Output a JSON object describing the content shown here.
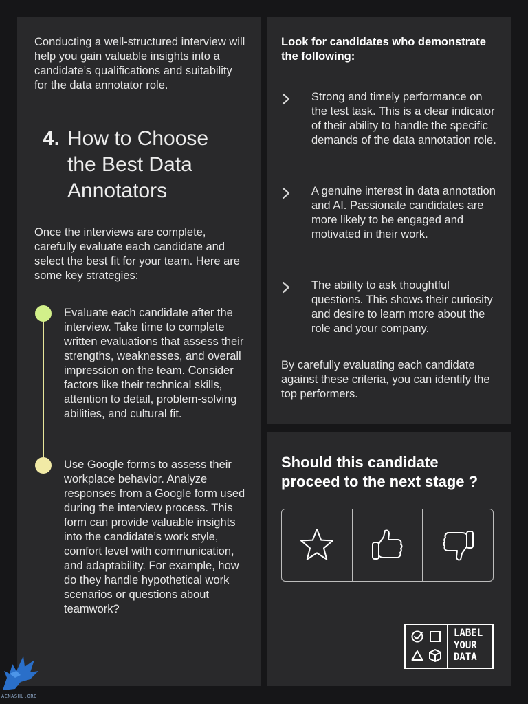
{
  "left_panel": {
    "intro": "Conducting a well-structured interview will help you gain valuable insights into a candidate’s qualifications and suitability for the data annotator role.",
    "section_number": "4.",
    "section_title": "How to Choose the Best Data Annotators",
    "strategies_intro": "Once the interviews are complete, carefully evaluate each candidate and select the best fit for your team. Here are some key strategies:",
    "timeline": [
      {
        "text": "Evaluate each candidate after the interview. Take time to complete written evaluations that assess their strengths, weaknesses, and overall impression on the team. Consider factors like their technical skills, attention to detail, problem-solving abilities, and cultural fit.",
        "color": "#d2f08a"
      },
      {
        "text": "Use Google forms to assess their workplace behavior. Analyze responses from a Google form used during the interview process. This form can provide valuable insights into the candidate’s work style, comfort level with communication, and adaptability. For example, how do they handle hypothetical work scenarios or questions about teamwork?",
        "color": "#f1eaa6"
      }
    ]
  },
  "right_top_panel": {
    "heading": "Look for candidates who demonstrate the following:",
    "criteria": [
      {
        "icon": "chevron-right-icon",
        "text": "Strong and timely performance on the test task. This is a clear indicator of their ability to handle the specific demands of the data annotation role."
      },
      {
        "icon": "chevron-right-icon",
        "text": "A genuine interest in data annotation and AI. Passionate candidates are more likely to be engaged and motivated in their work."
      },
      {
        "icon": "chevron-right-icon",
        "text": "The ability to ask thoughtful questions. This shows their curiosity and desire to learn more about the role and your company."
      }
    ],
    "closing": "By carefully evaluating each candidate against these criteria, you can identify the top performers."
  },
  "right_bottom_panel": {
    "question": "Should this candidate proceed to the next stage ?",
    "rating_options": [
      "star-icon",
      "thumbs-up-icon",
      "thumbs-down-icon"
    ],
    "brand": {
      "line1": "LABEL",
      "line2": "YOUR",
      "line3": "DATA"
    }
  },
  "watermark": {
    "text": "ACNASHU.ORG"
  },
  "colors": {
    "background": "#161618",
    "panel": "#29292b",
    "dot_green": "#d2f08a",
    "dot_yellow": "#f1eaa6"
  }
}
